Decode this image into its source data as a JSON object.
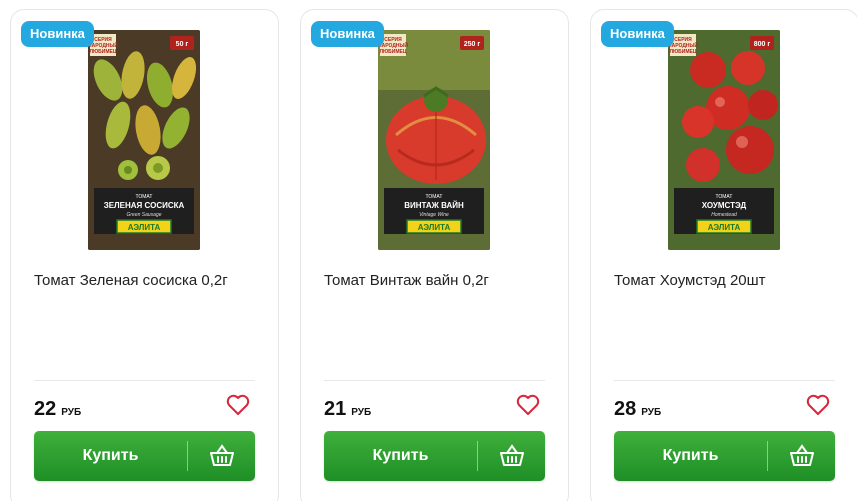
{
  "badge_color": "#24a8e0",
  "accent_green": "#2a9d2c",
  "products": [
    {
      "badge": "Новинка",
      "title": "Томат Зеленая сосиска 0,2г",
      "price": "22",
      "currency": "руб",
      "buy_label": "Купить",
      "pack": {
        "series_line1": "СЕРИЯ",
        "series_line2": "НАРОДНЫЙ",
        "series_line3": "ЛЮБИМЕЦ",
        "weight": "50 г",
        "kind": "ТОМАТ",
        "name": "ЗЕЛЕНАЯ СОСИСКА",
        "name_en": "Green Sausage",
        "brand": "АЭЛИТА"
      }
    },
    {
      "badge": "Новинка",
      "title": "Томат Винтаж вайн 0,2г",
      "price": "21",
      "currency": "руб",
      "buy_label": "Купить",
      "pack": {
        "series_line1": "СЕРИЯ",
        "series_line2": "НАРОДНЫЙ",
        "series_line3": "ЛЮБИМЕЦ",
        "weight": "250 г",
        "kind": "ТОМАТ",
        "name": "ВИНТАЖ ВАЙН",
        "name_en": "Vintage Wine",
        "brand": "АЭЛИТА"
      }
    },
    {
      "badge": "Новинка",
      "title": "Томат Хоумстэд 20шт",
      "price": "28",
      "currency": "руб",
      "buy_label": "Купить",
      "pack": {
        "series_line1": "СЕРИЯ",
        "series_line2": "НАРОДНЫЙ",
        "series_line3": "ЛЮБИМЕЦ",
        "weight": "800 г",
        "kind": "ТОМАТ",
        "name": "ХОУМСТЭД",
        "name_en": "Homestead",
        "brand": "АЭЛИТА"
      }
    }
  ]
}
